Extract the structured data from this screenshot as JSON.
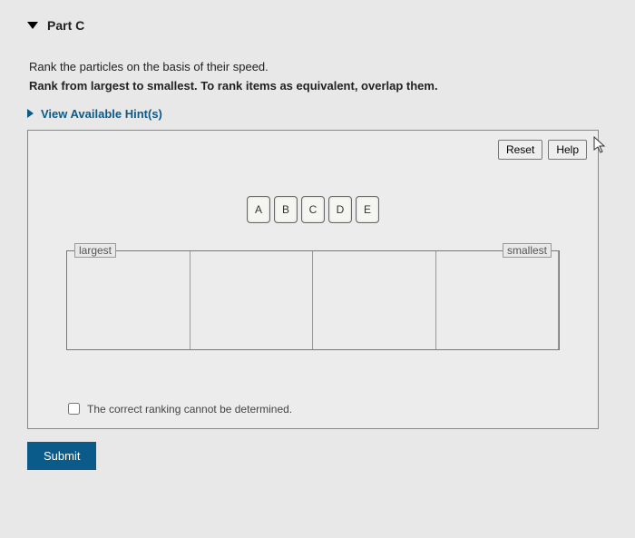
{
  "header": {
    "part_label": "Part C"
  },
  "instructions": {
    "line1": "Rank the particles on the basis of their speed.",
    "line2_bold": "Rank from largest to smallest. To rank items as equivalent, overlap them."
  },
  "hints": {
    "label": "View Available Hint(s)"
  },
  "workspace": {
    "reset_label": "Reset",
    "help_label": "Help",
    "tiles": [
      "A",
      "B",
      "C",
      "D",
      "E"
    ],
    "left_label": "largest",
    "right_label": "smallest",
    "cannot_determine_label": "The correct ranking cannot be determined."
  },
  "submit": {
    "label": "Submit"
  }
}
